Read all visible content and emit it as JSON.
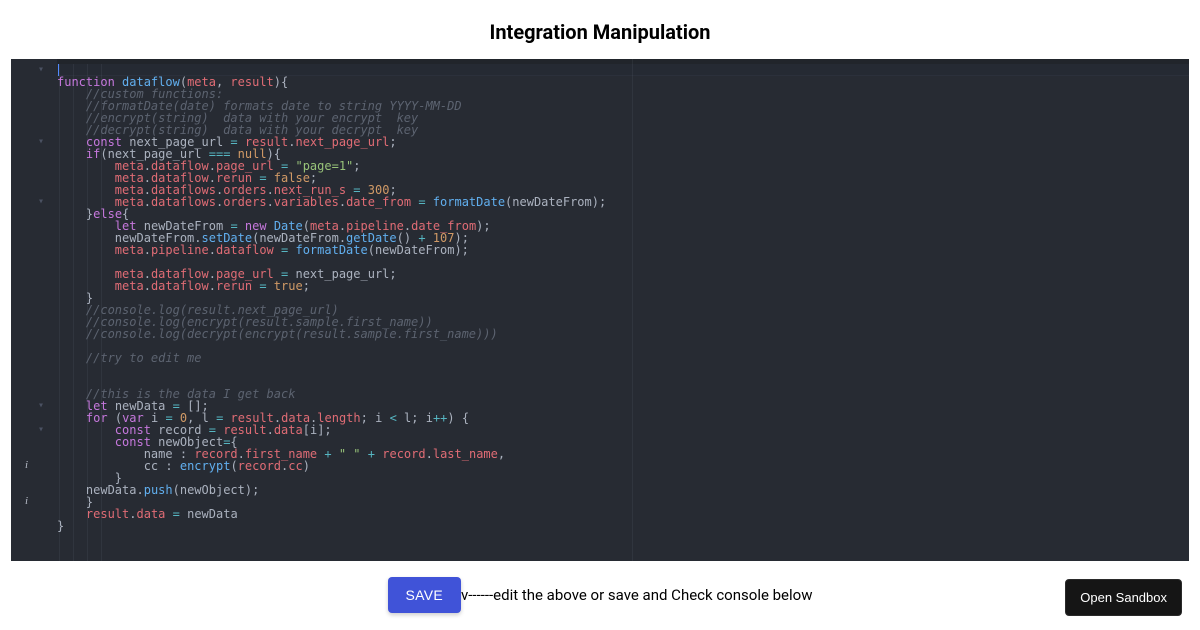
{
  "title": "Integration Manipulation",
  "buttons": {
    "save": "SAVE",
    "sandbox": "Open Sandbox"
  },
  "hint": "v------edit the above or save and Check console below",
  "fold_glyph": "▾",
  "info_glyph": "i",
  "code": {
    "l1": {
      "a": "function",
      "b": "dataflow",
      "c": "meta",
      "d": "result"
    },
    "l2": {
      "a": "//custom functions:"
    },
    "l3": {
      "a": "//formatDate(date) formats date to string YYYY-MM-DD"
    },
    "l4": {
      "a": "//encrypt(string)  data with your encrypt  key"
    },
    "l5": {
      "a": "//decrypt(string)  data with your decrypt  key"
    },
    "l6": {
      "a": "const",
      "b": "next_page_url",
      "c": "result",
      "d": "next_page_url"
    },
    "l7": {
      "a": "if",
      "b": "next_page_url",
      "c": "null"
    },
    "l8": {
      "a": "meta",
      "b": "dataflow",
      "c": "page_url",
      "d": "\"page=1\""
    },
    "l9": {
      "a": "meta",
      "b": "dataflow",
      "c": "rerun",
      "d": "false"
    },
    "l10": {
      "a": "meta",
      "b": "dataflows",
      "c": "orders",
      "d": "next_run_s",
      "e": "300"
    },
    "l11": {
      "a": "meta",
      "b": "dataflows",
      "c": "orders",
      "d": "variables",
      "e": "date_from",
      "f": "formatDate",
      "g": "newDateFrom"
    },
    "l12": {
      "a": "else"
    },
    "l13": {
      "a": "let",
      "b": "newDateFrom",
      "c": "new",
      "d": "Date",
      "e": "meta",
      "f": "pipeline",
      "g": "date_from"
    },
    "l14": {
      "a": "newDateFrom",
      "b": "setDate",
      "c": "newDateFrom",
      "d": "getDate",
      "e": "107"
    },
    "l15": {
      "a": "meta",
      "b": "pipeline",
      "c": "dataflow",
      "d": "formatDate",
      "e": "newDateFrom"
    },
    "l17": {
      "a": "meta",
      "b": "dataflow",
      "c": "page_url",
      "d": "next_page_url"
    },
    "l18": {
      "a": "meta",
      "b": "dataflow",
      "c": "rerun",
      "d": "true"
    },
    "l20": {
      "a": "//console.log(result.next_page_url)"
    },
    "l21": {
      "a": "//console.log(encrypt(result.sample.first_name))"
    },
    "l22": {
      "a": "//console.log(decrypt(encrypt(result.sample.first_name)))"
    },
    "l24": {
      "a": "//try to edit me"
    },
    "l27": {
      "a": "//this is the data I get back"
    },
    "l28": {
      "a": "let",
      "b": "newData"
    },
    "l29": {
      "a": "for",
      "b": "var",
      "c": "i",
      "d": "0",
      "e": "l",
      "f": "result",
      "g": "data",
      "h": "length",
      "i": "i",
      "j": "l",
      "k": "i"
    },
    "l30": {
      "a": "const",
      "b": "record",
      "c": "result",
      "d": "data",
      "e": "i"
    },
    "l31": {
      "a": "const",
      "b": "newObject"
    },
    "l32": {
      "a": "name",
      "b": "record",
      "c": "first_name",
      "d": "\" \"",
      "e": "record",
      "f": "last_name"
    },
    "l33": {
      "a": "cc",
      "b": "encrypt",
      "c": "record",
      "d": "cc"
    },
    "l35": {
      "a": "newData",
      "b": "push",
      "c": "newObject"
    },
    "l37": {
      "a": "result",
      "b": "data",
      "c": "newData"
    }
  }
}
